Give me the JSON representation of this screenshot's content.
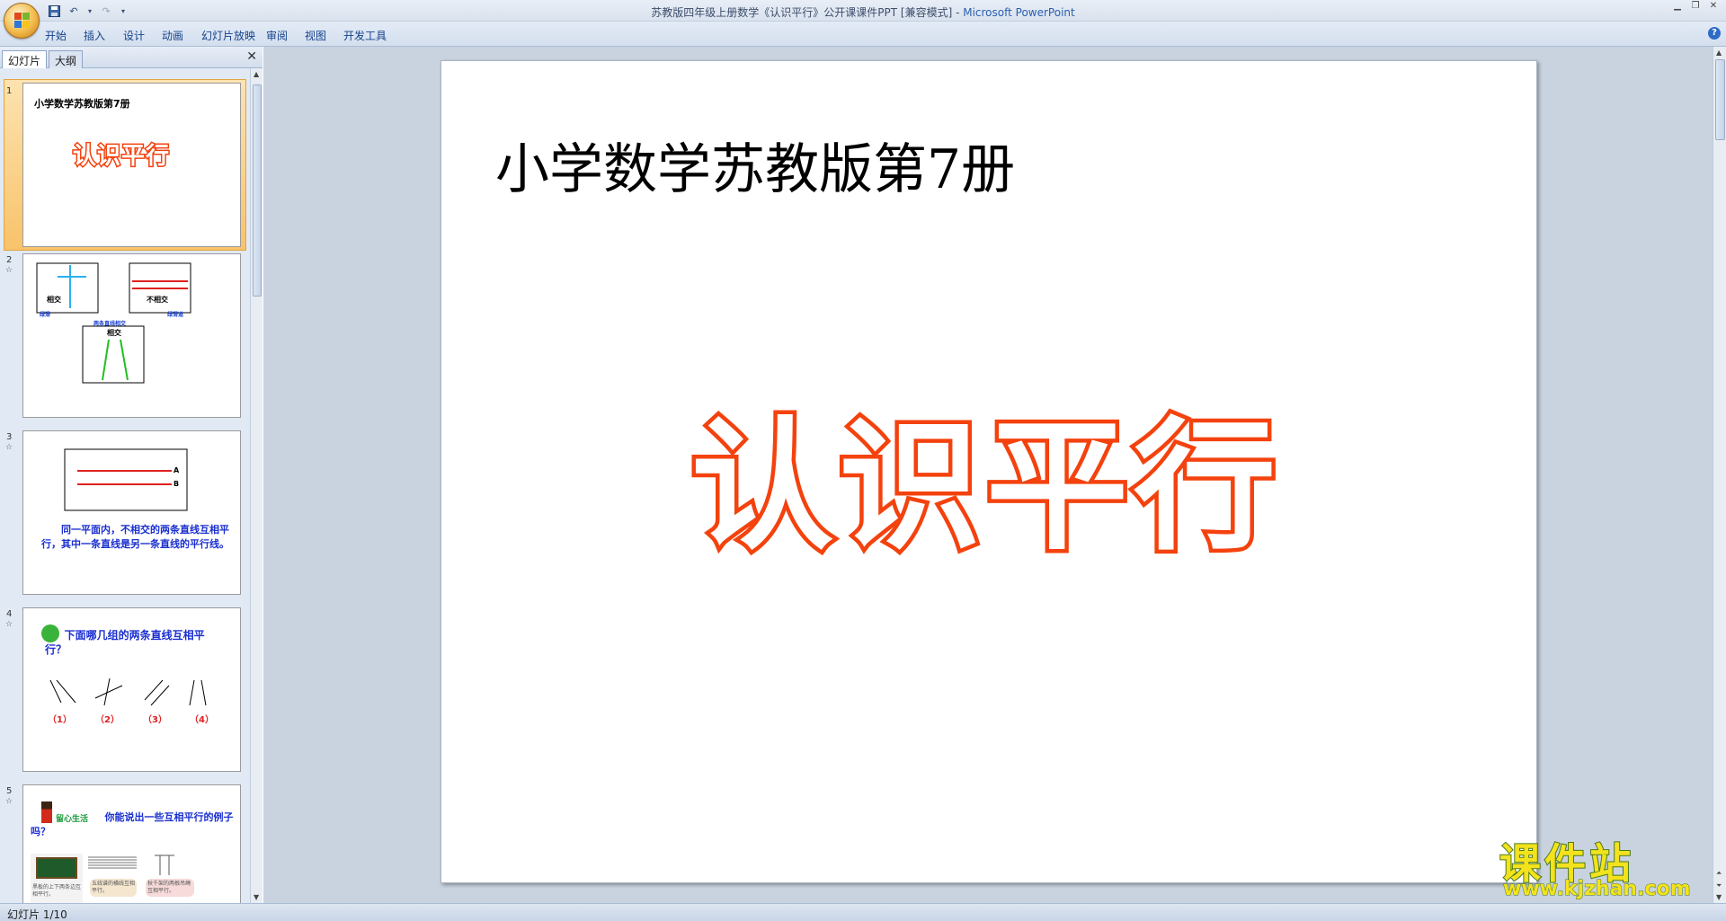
{
  "window": {
    "doc_title": "苏教版四年级上册数学《认识平行》公开课课件PPT [兼容模式]",
    "separator": " - ",
    "app_name": "Microsoft PowerPoint"
  },
  "ribbon": {
    "tabs": [
      "开始",
      "插入",
      "设计",
      "动画",
      "幻灯片放映",
      "审阅",
      "视图",
      "开发工具"
    ]
  },
  "pane": {
    "tab_slides": "幻灯片",
    "tab_outline": "大纲"
  },
  "thumbnails": [
    {
      "num": "1",
      "title": "小学数学苏教版第7册",
      "big": "认识平行"
    },
    {
      "num": "2",
      "labels": [
        "相交",
        "不相交",
        "相交"
      ],
      "small": [
        "绿滑",
        "两条直线相交",
        "绿滑道"
      ]
    },
    {
      "num": "3",
      "labels": [
        "A",
        "B"
      ],
      "text": "同一平面内，不相交的两条直线互相平行，其中一条直线是另一条直线的平行线。"
    },
    {
      "num": "4",
      "question": "下面哪几组的两条直线互相平行？",
      "options": [
        "（1）",
        "（2）",
        "（3）",
        "（4）"
      ]
    },
    {
      "num": "5",
      "tag": "留心生活",
      "question": "你能说出一些互相平行的例子吗？",
      "captions": [
        "黑板的上下两条边互相平行。",
        "五线谱的横线互相平行。",
        "秋千架的两根吊绳互相平行。"
      ]
    }
  ],
  "slide": {
    "title": "小学数学苏教版第7册",
    "big_text": "认识平行"
  },
  "status": {
    "slide_counter": "幻灯片 1/10"
  },
  "watermark": {
    "title": "课件站",
    "url": "www.kjzhan.com"
  },
  "colors": {
    "accent_red": "#f4420e",
    "ribbon_blue": "#15428b",
    "selection_orange": "#f8c36a"
  }
}
